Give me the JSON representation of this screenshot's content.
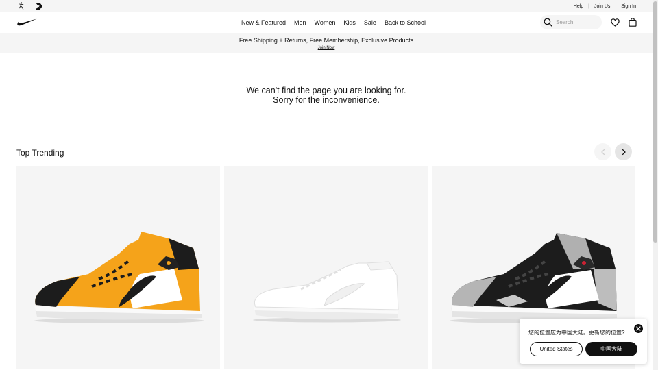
{
  "utility_bar": {
    "brand_icons": [
      "jordan-jumpman-icon",
      "converse-star-chevron-icon"
    ],
    "links": [
      "Help",
      "Join Us",
      "Sign In"
    ],
    "separator": "|"
  },
  "nav": {
    "logo": "nike-swoosh-logo",
    "menu": [
      "New & Featured",
      "Men",
      "Women",
      "Kids",
      "Sale",
      "Back to School"
    ],
    "search": {
      "placeholder": "Search",
      "value": ""
    },
    "icons": [
      "search-icon",
      "heart-icon",
      "bag-icon"
    ]
  },
  "promo": {
    "message": "Free Shipping + Returns, Free Membership, Exclusive Products",
    "link": "Join Now"
  },
  "error": {
    "line1": "We can't find the page you are looking for.",
    "line2": "Sorry for the inconvenience."
  },
  "trending": {
    "title": "Top Trending",
    "prev_disabled": true,
    "products": [
      {
        "image": "yellow-black-white-mid-sneaker",
        "colors": [
          "#f5a31a",
          "#1c1c1c",
          "#ffffff"
        ]
      },
      {
        "image": "all-white-low-sneaker",
        "colors": [
          "#ffffff",
          "#e8e8e8"
        ]
      },
      {
        "image": "black-grey-cement-mid-sneaker",
        "colors": [
          "#1c1c1c",
          "#b5b5b5",
          "#ffffff"
        ]
      }
    ]
  },
  "location_popup": {
    "question": "您的位置应为中国大陆。更新您的位置?",
    "secondary_button": "United States",
    "primary_button": "中国大陆"
  },
  "colors": {
    "text": "#111111",
    "surface_grey": "#f5f5f5",
    "accent_yellow": "#f5a31a"
  }
}
